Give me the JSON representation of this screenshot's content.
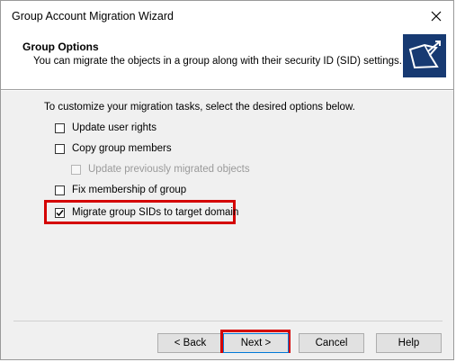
{
  "window": {
    "title": "Group Account Migration Wizard"
  },
  "header": {
    "title": "Group Options",
    "subtitle": "You can migrate the objects in a group along with their security ID (SID) settings."
  },
  "body": {
    "instruction": "To customize your migration tasks, select the desired options below.",
    "options": [
      {
        "label": "Update user rights",
        "checked": false,
        "enabled": true
      },
      {
        "label": "Copy group members",
        "checked": false,
        "enabled": true
      },
      {
        "label": "Update previously migrated objects",
        "checked": false,
        "enabled": false
      },
      {
        "label": "Fix membership of group",
        "checked": false,
        "enabled": true
      },
      {
        "label": "Migrate group SIDs to target domain",
        "checked": true,
        "enabled": true
      }
    ]
  },
  "buttons": {
    "back": "< Back",
    "next": "Next >",
    "cancel": "Cancel",
    "help": "Help"
  },
  "colors": {
    "highlight": "#d40000",
    "icon_bg": "#173a72"
  }
}
